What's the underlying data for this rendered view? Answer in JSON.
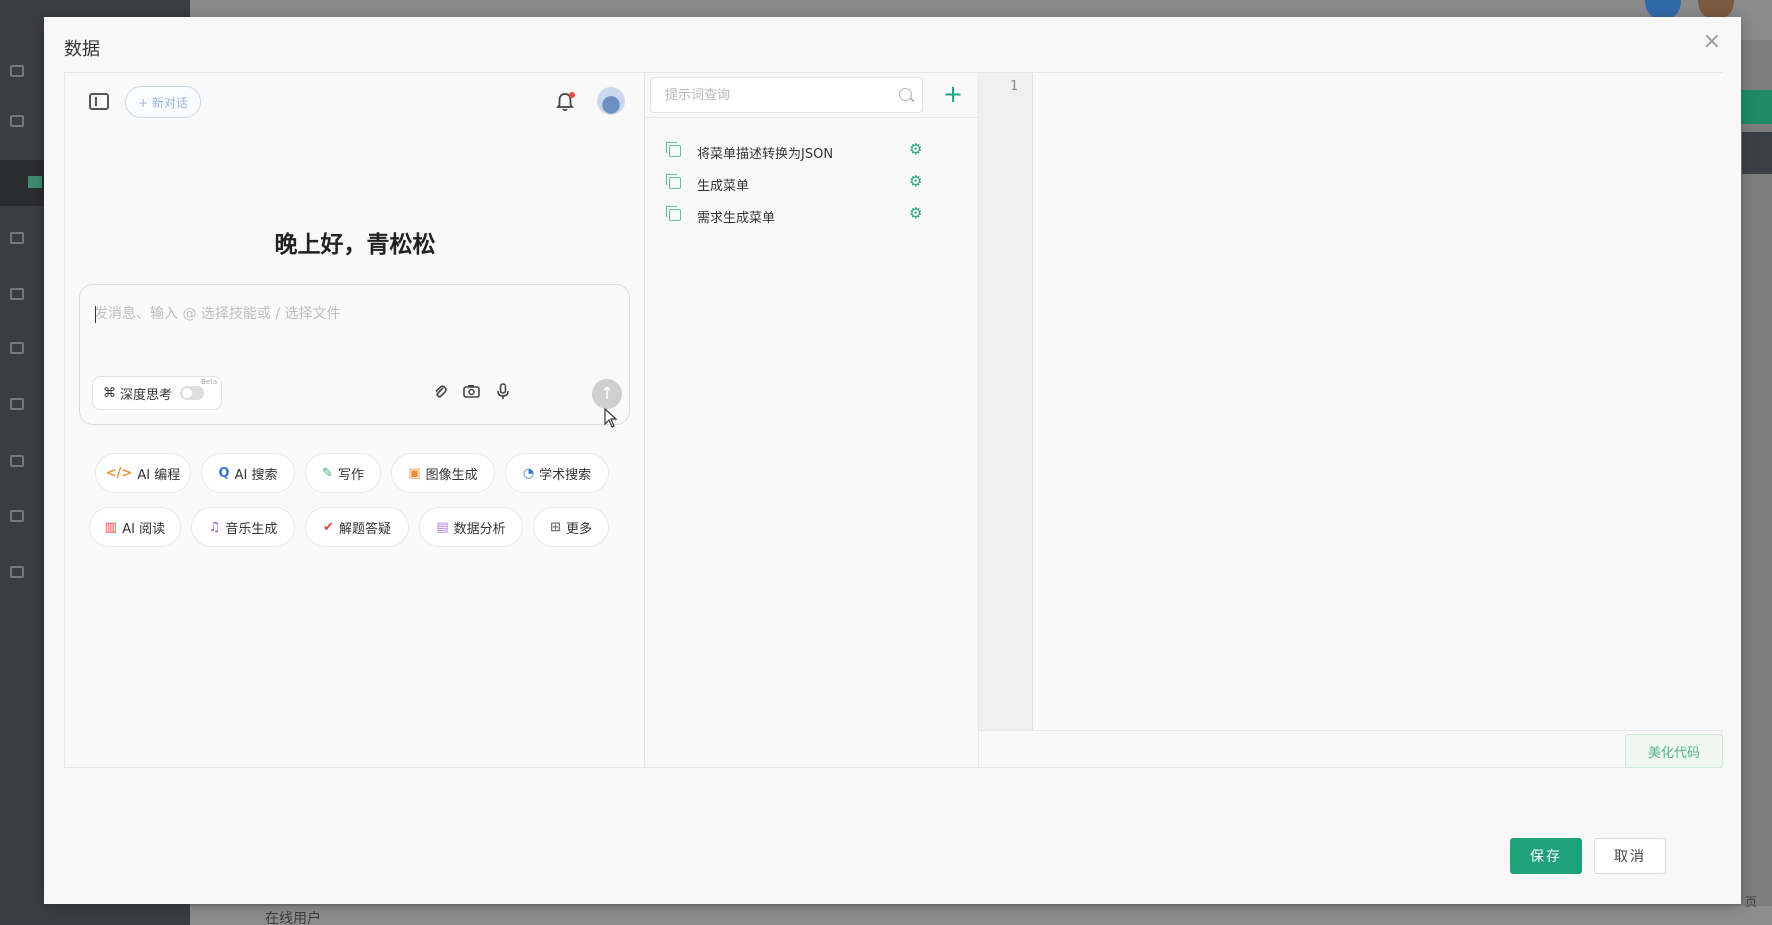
{
  "background": {
    "online_users": "在线用户",
    "page_label": "页"
  },
  "modal": {
    "title": "数据",
    "close_label": "×",
    "save_label": "保存",
    "cancel_label": "取消"
  },
  "chat": {
    "new_chat_label": "+ 新对话",
    "greeting": "晚上好，青松松",
    "input_placeholder": "发消息、输入 @ 选择技能或 / 选择文件",
    "input_value": "",
    "deep_think_label": "深度思考",
    "beta_label": "Beta",
    "send_glyph": "↑",
    "chips": [
      {
        "label": "AI 编程",
        "icon": "</>",
        "color": "#e8913a"
      },
      {
        "label": "AI 搜索",
        "icon": "Q",
        "color": "#3b6fd8"
      },
      {
        "label": "写作",
        "icon": "✎",
        "color": "#3aae6a"
      },
      {
        "label": "图像生成",
        "icon": "▣",
        "color": "#e8913a"
      },
      {
        "label": "学术搜索",
        "icon": "◔",
        "color": "#3b6fd8"
      },
      {
        "label": "AI 阅读",
        "icon": "▥",
        "color": "#e04848"
      },
      {
        "label": "音乐生成",
        "icon": "♫",
        "color": "#8a5cd8"
      },
      {
        "label": "解题答疑",
        "icon": "✔",
        "color": "#e04848"
      },
      {
        "label": "数据分析",
        "icon": "▤",
        "color": "#b07ad8"
      },
      {
        "label": "更多",
        "icon": "⊞",
        "color": "#777777"
      }
    ]
  },
  "prompts": {
    "search_placeholder": "提示词查询",
    "add_glyph": "+",
    "items": [
      {
        "label": "将菜单描述转换为JSON"
      },
      {
        "label": "生成菜单"
      },
      {
        "label": "需求生成菜单"
      }
    ]
  },
  "editor": {
    "line_numbers": [
      "1"
    ],
    "beautify_label": "美化代码"
  }
}
